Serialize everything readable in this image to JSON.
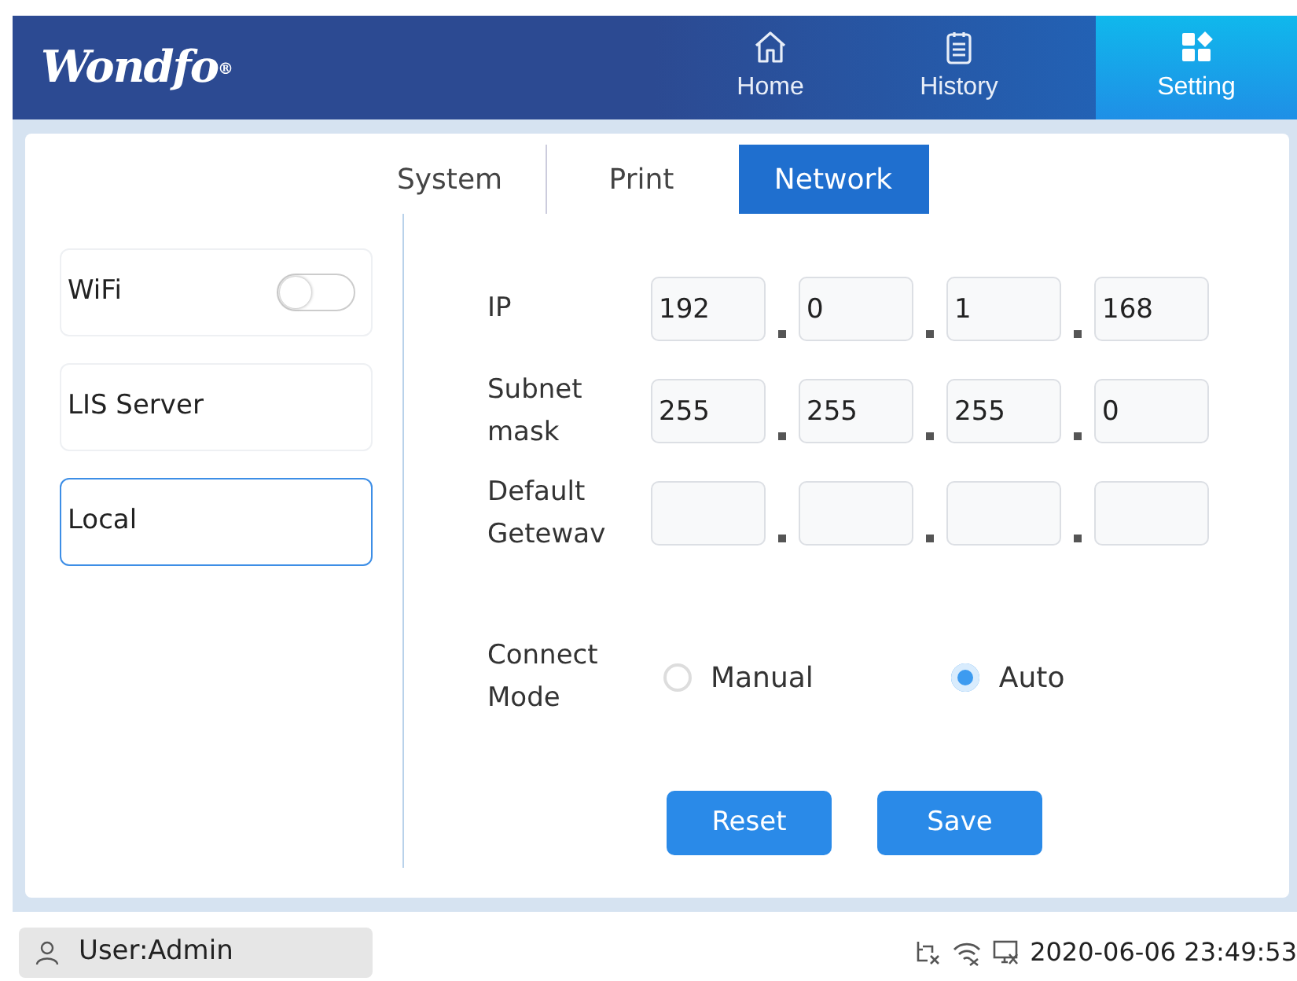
{
  "header": {
    "logo": "Wondfo",
    "logo_mark": "®",
    "nav": [
      {
        "label": "Home",
        "selected": false
      },
      {
        "label": "History",
        "selected": false
      },
      {
        "label": "Setting",
        "selected": true
      }
    ]
  },
  "tabs": [
    {
      "label": "System",
      "selected": false
    },
    {
      "label": "Print",
      "selected": false
    },
    {
      "label": "Network",
      "selected": true
    }
  ],
  "sidebar": [
    {
      "label": "WiFi",
      "kind": "toggle",
      "on": false,
      "selected": false
    },
    {
      "label": "LIS Server",
      "kind": "item",
      "selected": false
    },
    {
      "label": "Local",
      "kind": "item",
      "selected": true
    }
  ],
  "form": {
    "rows": [
      {
        "label": "IP",
        "octets": [
          "192",
          "0",
          "1",
          "168"
        ]
      },
      {
        "label": "Subnet mask",
        "octets": [
          "255",
          "255",
          "255",
          "0"
        ]
      },
      {
        "label": "Default Getewav"
      }
    ],
    "connect_mode": {
      "label": "Connect Mode",
      "options": [
        {
          "label": "Manual",
          "selected": false
        },
        {
          "label": "Auto",
          "selected": true
        }
      ]
    },
    "buttons": [
      "Reset",
      "Save"
    ]
  },
  "status_bar": {
    "user": "User:Admin",
    "datetime": "2020-06-06 23:49:53"
  }
}
